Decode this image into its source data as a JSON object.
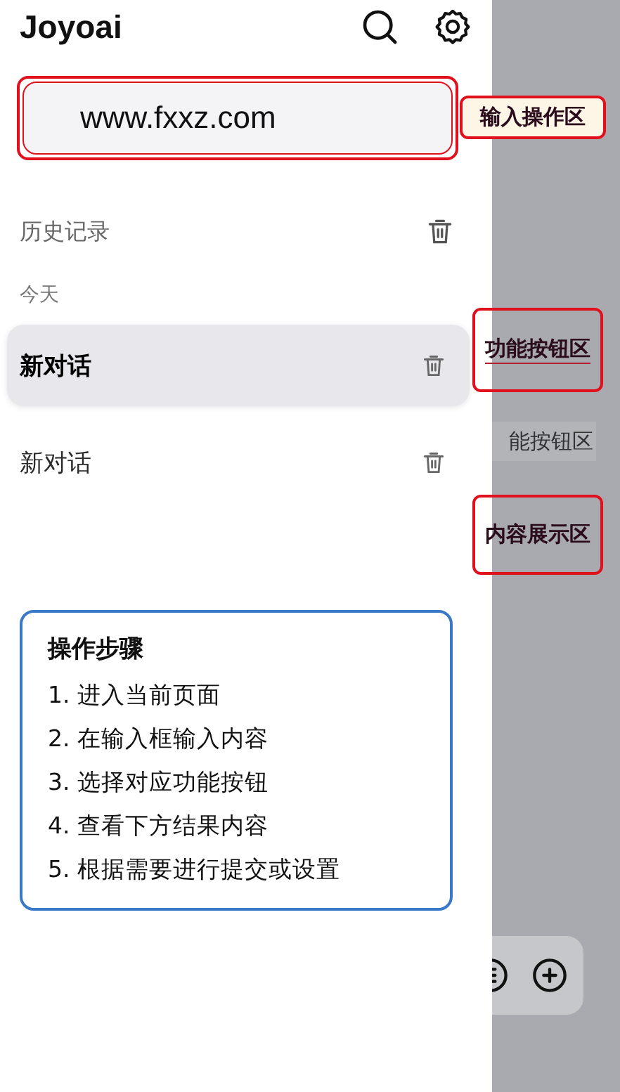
{
  "header": {
    "title": "Joyoai"
  },
  "input": {
    "value": "www.fxxz.com"
  },
  "history": {
    "title": "历史记录",
    "groups": [
      {
        "label": "今天",
        "items": [
          {
            "title": "新对话",
            "selected": true
          },
          {
            "title": "新对话",
            "selected": false
          }
        ]
      }
    ]
  },
  "steps": {
    "title": "操作步骤",
    "items": [
      "1. 进入当前页面",
      "2. 在输入框输入内容",
      "3. 选择对应功能按钮",
      "4. 查看下方结果内容",
      "5. 根据需要进行提交或设置"
    ]
  },
  "background": {
    "partial_label": "能按钮区"
  },
  "annotations": [
    {
      "text": "输入操作区"
    },
    {
      "text": "功能按钮区"
    },
    {
      "text": "内容展示区"
    }
  ]
}
